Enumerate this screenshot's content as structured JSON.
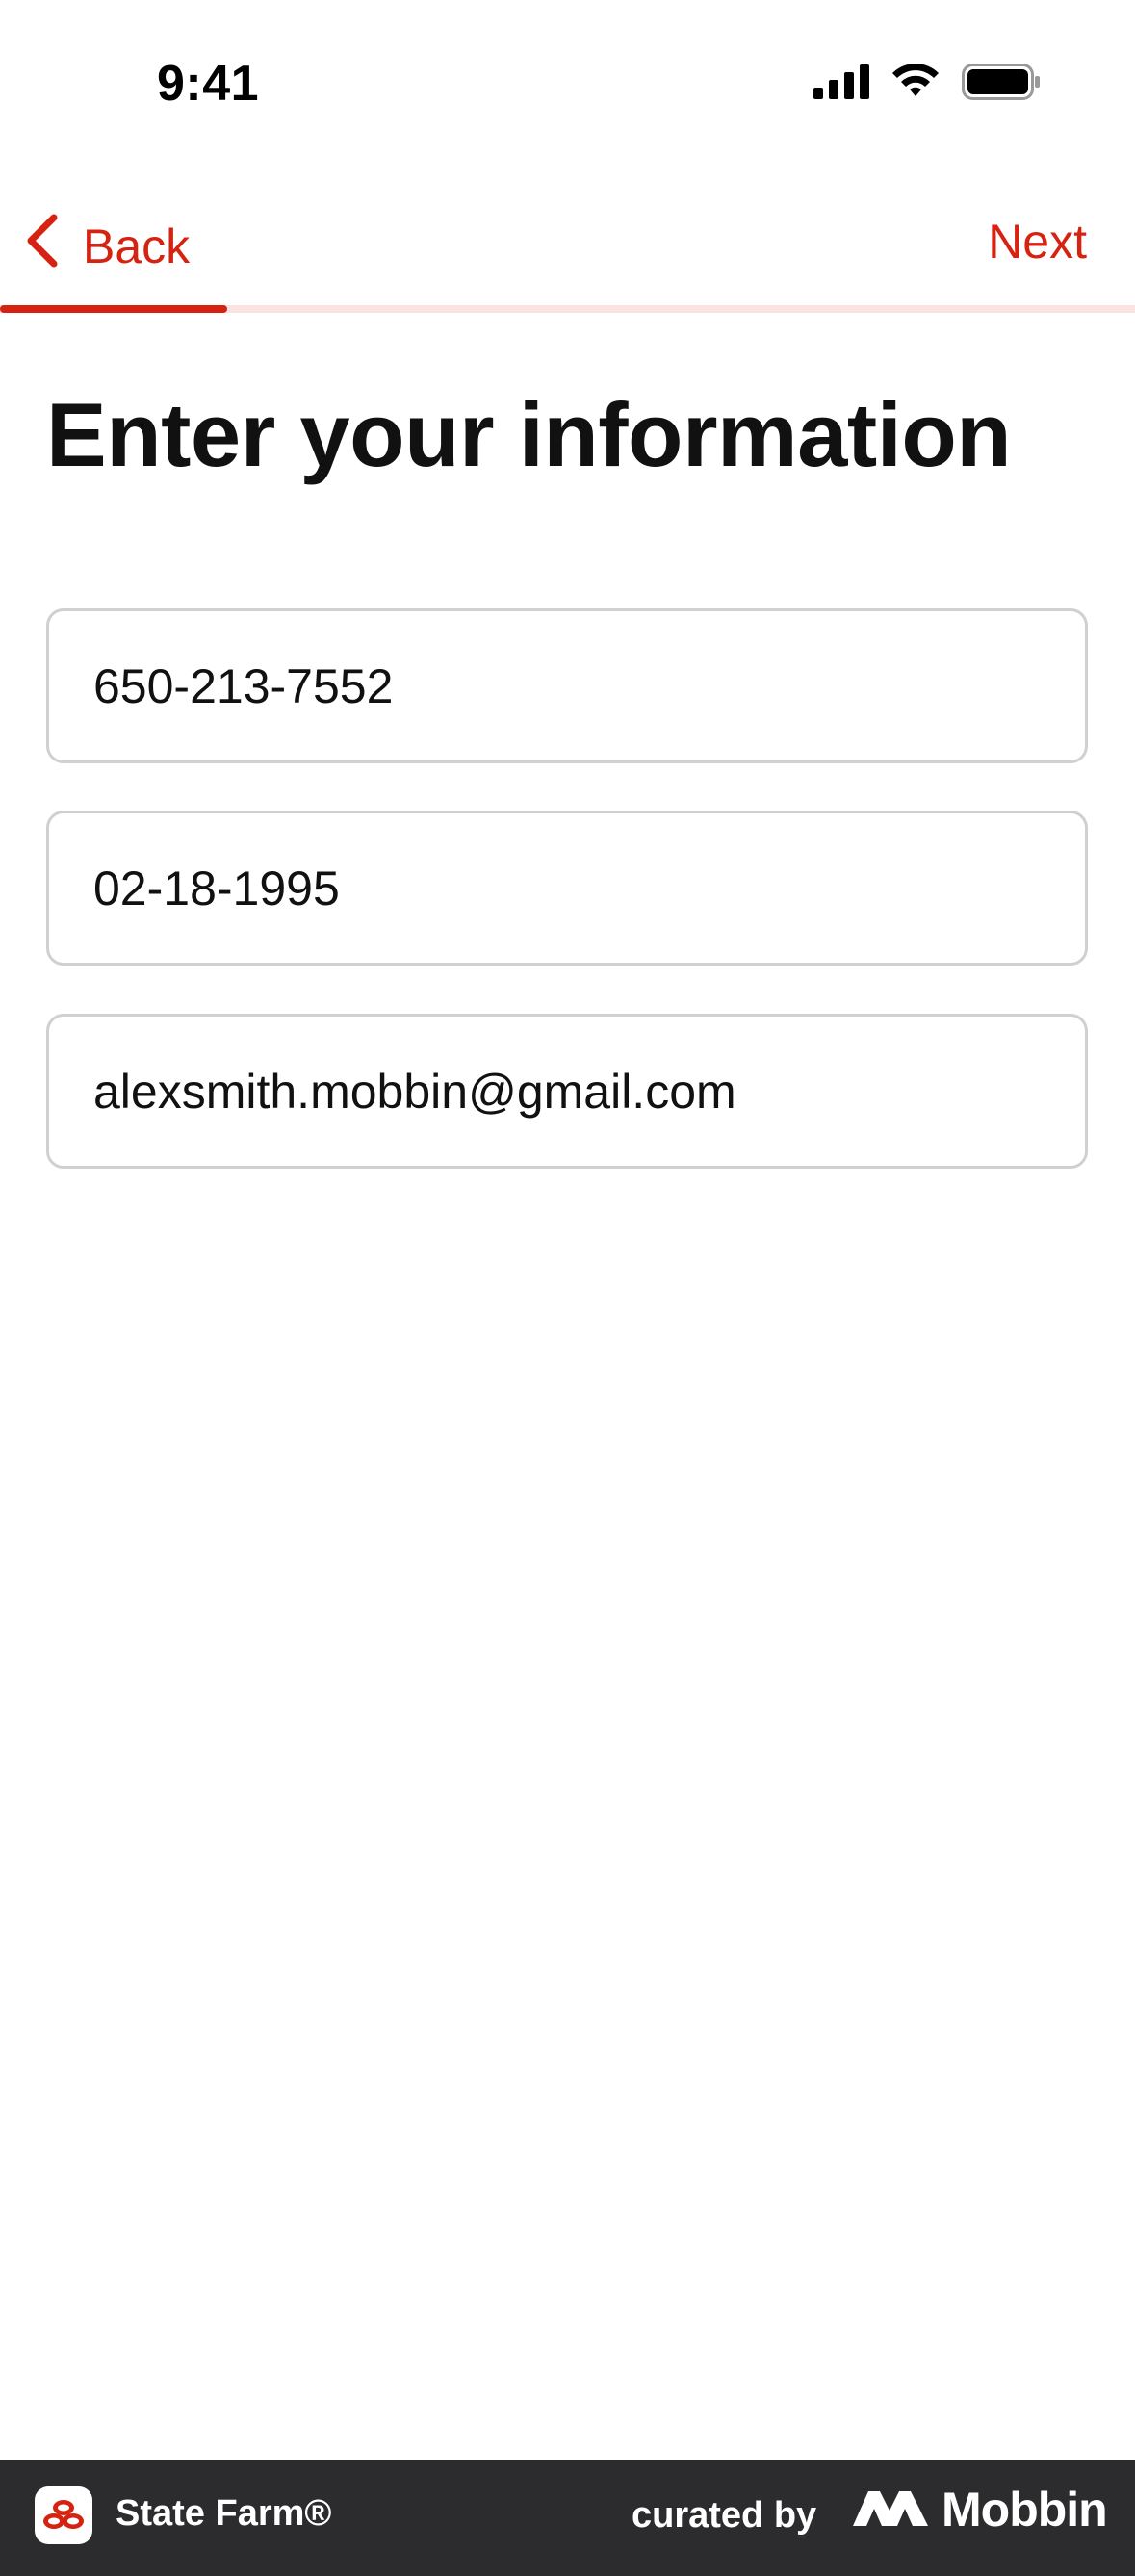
{
  "status_bar": {
    "time": "9:41"
  },
  "nav": {
    "back_label": "Back",
    "next_label": "Next",
    "progress": 0.2
  },
  "page": {
    "title": "Enter your information"
  },
  "form": {
    "phone": "650-213-7552",
    "dob": "02-18-1995",
    "email": "alexsmith.mobbin@gmail.com"
  },
  "footer": {
    "app_name": "State Farm®",
    "curated_by": "curated by",
    "brand": "Mobbin"
  },
  "colors": {
    "accent": "#d62311",
    "progress_track": "#fbe3e1",
    "footer_bg": "#2c2c2e"
  }
}
